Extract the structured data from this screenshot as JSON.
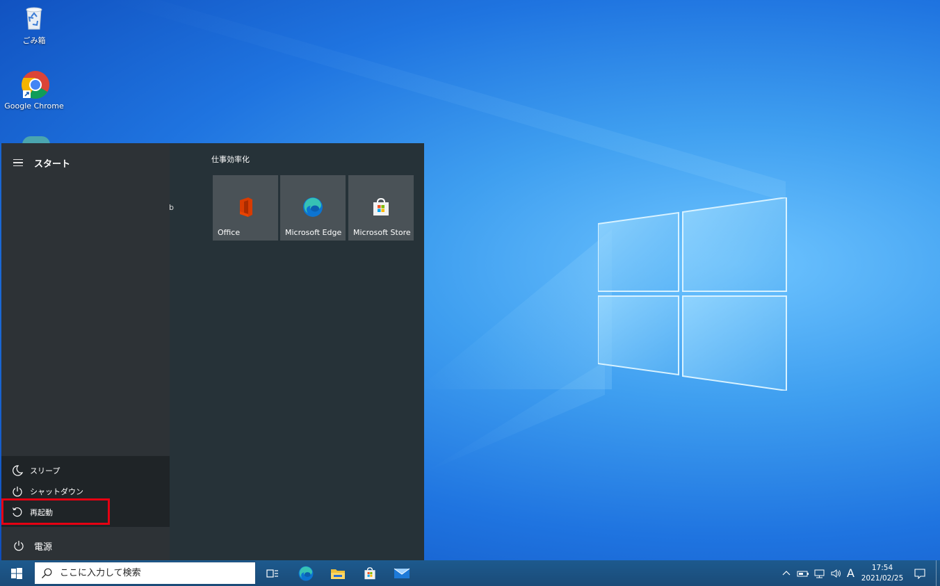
{
  "desktop": {
    "icons": [
      {
        "label": "ごみ箱",
        "icon": "recycle-bin-icon"
      },
      {
        "label": "Google Chrome",
        "icon": "chrome-icon"
      }
    ]
  },
  "start_menu": {
    "title": "スタート",
    "clipped_letter": "b",
    "group_title": "仕事効率化",
    "tiles": [
      {
        "label": "Office",
        "icon": "office-icon"
      },
      {
        "label": "Microsoft Edge",
        "icon": "edge-icon"
      },
      {
        "label": "Microsoft Store",
        "icon": "store-icon"
      }
    ],
    "power_menu": {
      "items": [
        {
          "label": "スリープ",
          "icon": "moon-icon"
        },
        {
          "label": "シャットダウン",
          "icon": "power-icon"
        },
        {
          "label": "再起動",
          "icon": "restart-icon"
        }
      ],
      "highlighted_item": "再起動",
      "highlight_color": "#e60012"
    },
    "power_label": "電源"
  },
  "taskbar": {
    "search_placeholder": "ここに入力して検索",
    "pinned": [
      "task-view-icon",
      "edge-icon",
      "file-explorer-icon",
      "store-icon",
      "mail-icon"
    ],
    "tray": {
      "ime_indicator": "A",
      "time": "17:54",
      "date": "2021/02/25"
    }
  },
  "colors": {
    "start_bg": "#263238",
    "tile_bg": "#4a5257",
    "taskbar_bg": "#1a4b78"
  }
}
